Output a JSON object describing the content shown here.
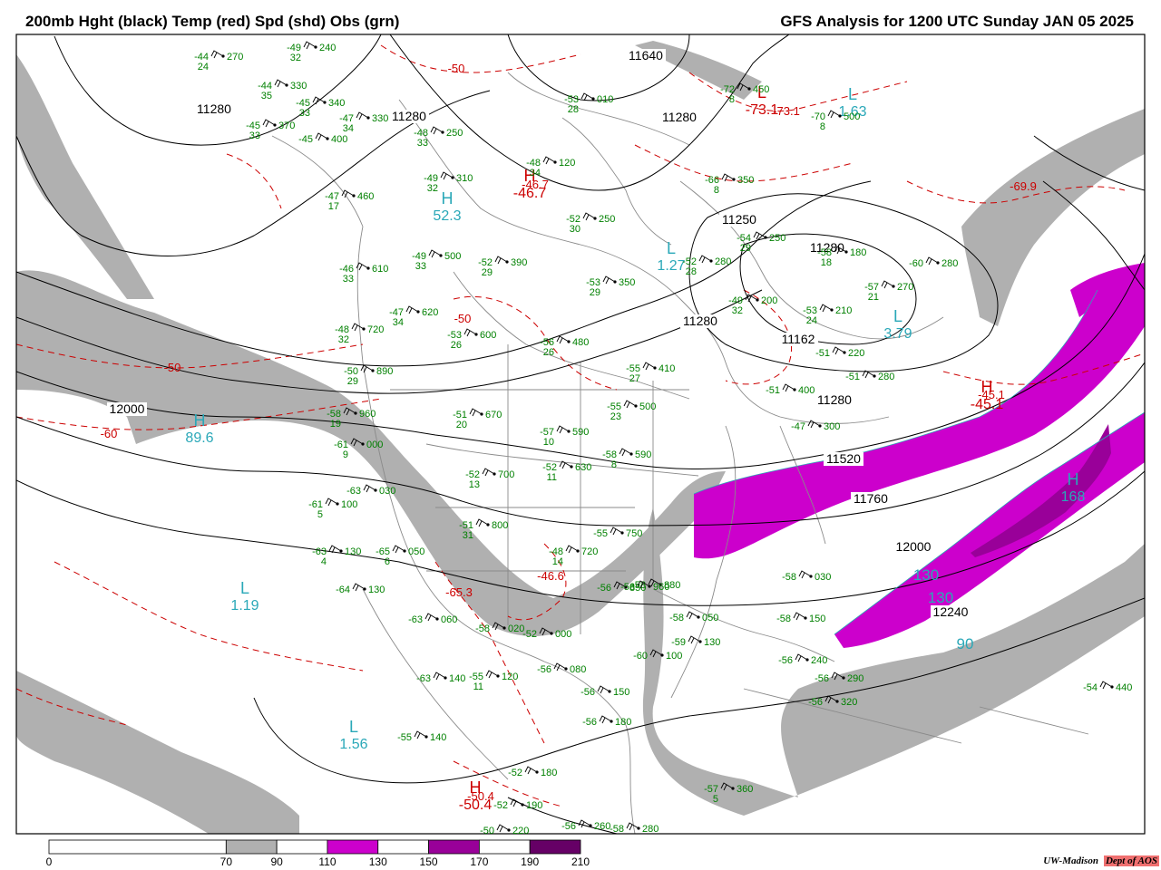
{
  "header": {
    "title_left": "200mb Hght (black) Temp (red) Spd (shd) Obs (grn)",
    "title_right": "GFS Analysis for 1200 UTC Sunday  JAN 05 2025"
  },
  "colors": {
    "height": "#000000",
    "temp": "#cc0000",
    "obs": "#008000",
    "speed_center": "#2aa8b8",
    "shade_70": "#b0b0b0",
    "shade_110": "#cc00cc",
    "shade_150": "#990099",
    "shade_190": "#660066"
  },
  "colorbar": {
    "labels": [
      "0",
      "70",
      "90",
      "110",
      "130",
      "150",
      "170",
      "190",
      "210"
    ],
    "bins": [
      {
        "from": 0,
        "to": 70,
        "color": "#ffffff"
      },
      {
        "from": 70,
        "to": 90,
        "color": "#b0b0b0"
      },
      {
        "from": 90,
        "to": 110,
        "color": "#ffffff"
      },
      {
        "from": 110,
        "to": 130,
        "color": "#cc00cc"
      },
      {
        "from": 130,
        "to": 150,
        "color": "#ffffff"
      },
      {
        "from": 150,
        "to": 170,
        "color": "#990099"
      },
      {
        "from": 170,
        "to": 190,
        "color": "#ffffff"
      },
      {
        "from": 190,
        "to": 210,
        "color": "#660066"
      }
    ]
  },
  "credit": {
    "org": "UW-Madison",
    "dept": "Dept of AOS"
  },
  "height_labels": [
    "11280",
    "11280",
    "11280",
    "11280",
    "11280",
    "11250",
    "11280",
    "11280",
    "11162",
    "11280",
    "11520",
    "11760",
    "12000",
    "12000",
    "12240",
    "11640"
  ],
  "temp_labels": [
    "-50",
    "-50",
    "-50",
    "-60",
    "-73.1",
    "-46.7",
    "-69.9",
    "-45.1",
    "-46.6",
    "-65.3",
    "-50.4"
  ],
  "centers": [
    {
      "type": "H",
      "value": "52.3",
      "kind": "speed"
    },
    {
      "type": "H",
      "value": "89.6",
      "kind": "speed"
    },
    {
      "type": "L",
      "value": "1.27",
      "kind": "speed"
    },
    {
      "type": "L",
      "value": "1.63",
      "kind": "speed"
    },
    {
      "type": "L",
      "value": "1.19",
      "kind": "speed"
    },
    {
      "type": "L",
      "value": "1.56",
      "kind": "speed"
    },
    {
      "type": "L",
      "value": "3.79",
      "kind": "speed"
    },
    {
      "type": "H",
      "value": "168",
      "kind": "speed"
    },
    {
      "type": "H",
      "value": "-46.7",
      "kind": "temp"
    },
    {
      "type": "H",
      "value": "-45.1",
      "kind": "temp"
    },
    {
      "type": "H",
      "value": "-50.4",
      "kind": "temp"
    },
    {
      "type": "L",
      "value": "-73.1",
      "kind": "temp"
    }
  ],
  "speed_labels": [
    "130",
    "130",
    "90"
  ],
  "observations": [
    {
      "t": "-44",
      "d": "24",
      "h": "270"
    },
    {
      "t": "-44",
      "d": "35",
      "h": "330"
    },
    {
      "t": "-45",
      "d": "33",
      "h": "340"
    },
    {
      "t": "-45",
      "d": "33",
      "h": "370"
    },
    {
      "t": "-45",
      "d": "",
      "h": "400"
    },
    {
      "t": "-47",
      "d": "34",
      "h": "330"
    },
    {
      "t": "-48",
      "d": "33",
      "h": "250"
    },
    {
      "t": "-49",
      "d": "32",
      "h": "310"
    },
    {
      "t": "-47",
      "d": "17",
      "h": "460"
    },
    {
      "t": "-48",
      "d": "34",
      "h": "120"
    },
    {
      "t": "-52",
      "d": "30",
      "h": "250"
    },
    {
      "t": "-53",
      "d": "28",
      "h": "010"
    },
    {
      "t": "-49",
      "d": "33",
      "h": "500"
    },
    {
      "t": "-52",
      "d": "29",
      "h": "390"
    },
    {
      "t": "-53",
      "d": "29",
      "h": "350"
    },
    {
      "t": "-47",
      "d": "34",
      "h": "620"
    },
    {
      "t": "-53",
      "d": "26",
      "h": "600"
    },
    {
      "t": "-56",
      "d": "26",
      "h": "480"
    },
    {
      "t": "-55",
      "d": "27",
      "h": "410"
    },
    {
      "t": "-55",
      "d": "23",
      "h": "500"
    },
    {
      "t": "-51",
      "d": "20",
      "h": "670"
    },
    {
      "t": "-57",
      "d": "10",
      "h": "590"
    },
    {
      "t": "-52",
      "d": "13",
      "h": "700"
    },
    {
      "t": "-52",
      "d": "11",
      "h": "630"
    },
    {
      "t": "-58",
      "d": "8",
      "h": "590"
    },
    {
      "t": "-51",
      "d": "31",
      "h": "800"
    },
    {
      "t": "-48",
      "d": "14",
      "h": "720"
    },
    {
      "t": "-55",
      "d": "",
      "h": "750"
    },
    {
      "t": "-56",
      "d": "",
      "h": "850"
    },
    {
      "t": "-58",
      "d": "",
      "h": "880"
    },
    {
      "t": "-56",
      "d": "",
      "h": "960"
    },
    {
      "t": "-52",
      "d": "",
      "h": "000"
    },
    {
      "t": "-56",
      "d": "",
      "h": "080"
    },
    {
      "t": "-60",
      "d": "",
      "h": "100"
    },
    {
      "t": "-59",
      "d": "",
      "h": "130"
    },
    {
      "t": "-56",
      "d": "",
      "h": "150"
    },
    {
      "t": "-56",
      "d": "",
      "h": "180"
    },
    {
      "t": "-52",
      "d": "",
      "h": "180"
    },
    {
      "t": "-52",
      "d": "",
      "h": "190"
    },
    {
      "t": "-50",
      "d": "",
      "h": "220"
    },
    {
      "t": "-56",
      "d": "",
      "h": "260"
    },
    {
      "t": "-58",
      "d": "",
      "h": "280"
    },
    {
      "t": "-57",
      "d": "5",
      "h": "360"
    },
    {
      "t": "-56",
      "d": "",
      "h": "290"
    },
    {
      "t": "-56",
      "d": "",
      "h": "320"
    },
    {
      "t": "-54",
      "d": "",
      "h": "440"
    },
    {
      "t": "-58",
      "d": "",
      "h": "030"
    },
    {
      "t": "-58",
      "d": "",
      "h": "150"
    },
    {
      "t": "-56",
      "d": "",
      "h": "240"
    },
    {
      "t": "-58",
      "d": "",
      "h": "050"
    },
    {
      "t": "-58",
      "d": "",
      "h": "020"
    },
    {
      "t": "-55",
      "d": "",
      "h": "140"
    },
    {
      "t": "-63",
      "d": "",
      "h": "140"
    },
    {
      "t": "-55",
      "d": "11",
      "h": "120"
    },
    {
      "t": "-63",
      "d": "",
      "h": "060"
    },
    {
      "t": "-64",
      "d": "",
      "h": "130"
    },
    {
      "t": "-63",
      "d": "4",
      "h": "130"
    },
    {
      "t": "-65",
      "d": "6",
      "h": "050"
    },
    {
      "t": "-61",
      "d": "5",
      "h": "100"
    },
    {
      "t": "-63",
      "d": "",
      "h": "030"
    },
    {
      "t": "-61",
      "d": "9",
      "h": "000"
    },
    {
      "t": "-58",
      "d": "19",
      "h": "960"
    },
    {
      "t": "-50",
      "d": "29",
      "h": "890"
    },
    {
      "t": "-48",
      "d": "32",
      "h": "720"
    },
    {
      "t": "-46",
      "d": "33",
      "h": "610"
    },
    {
      "t": "-72",
      "d": "8",
      "h": "450"
    },
    {
      "t": "-70",
      "d": "8",
      "h": "500"
    },
    {
      "t": "-66",
      "d": "8",
      "h": "350"
    },
    {
      "t": "-54",
      "d": "29",
      "h": "250"
    },
    {
      "t": "-52",
      "d": "28",
      "h": "280"
    },
    {
      "t": "-49",
      "d": "32",
      "h": "200"
    },
    {
      "t": "-53",
      "d": "24",
      "h": "210"
    },
    {
      "t": "-58",
      "d": "18",
      "h": "180"
    },
    {
      "t": "-57",
      "d": "21",
      "h": "270"
    },
    {
      "t": "-60",
      "d": "",
      "h": "280"
    },
    {
      "t": "-51",
      "d": "",
      "h": "220"
    },
    {
      "t": "-51",
      "d": "",
      "h": "280"
    },
    {
      "t": "-51",
      "d": "",
      "h": "400"
    },
    {
      "t": "-47",
      "d": "",
      "h": "300"
    },
    {
      "t": "-49",
      "d": "32",
      "h": "240"
    }
  ]
}
